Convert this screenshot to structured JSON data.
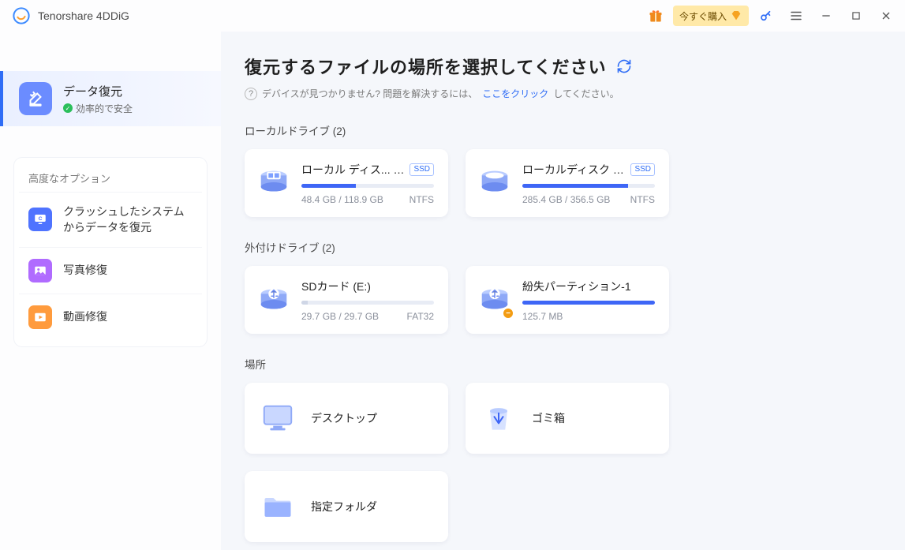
{
  "app": {
    "title": "Tenorshare 4DDiG"
  },
  "titlebar": {
    "buy_label": "今すぐ購入"
  },
  "sidebar": {
    "primary": {
      "title": "データ復元",
      "subtitle": "効率的で安全"
    },
    "advanced_header": "高度なオプション",
    "advanced": [
      {
        "label": "クラッシュしたシステムからデータを復元"
      },
      {
        "label": "写真修復"
      },
      {
        "label": "動画修復"
      }
    ]
  },
  "main": {
    "title": "復元するファイルの場所を選択してください",
    "help_prefix": "デバイスが見つかりません? 問題を解決するには、",
    "help_link": "ここをクリック",
    "help_suffix": "してください。"
  },
  "sections": {
    "local": {
      "title": "ローカルドライブ (2)",
      "drives": [
        {
          "name": "ローカル ディス... (C:)",
          "ssd": "SSD",
          "used": "48.4 GB / 118.9 GB",
          "fs": "NTFS",
          "fill": 41
        },
        {
          "name": "ローカルディスク (D:)",
          "ssd": "SSD",
          "used": "285.4 GB / 356.5 GB",
          "fs": "NTFS",
          "fill": 80
        }
      ]
    },
    "external": {
      "title": "外付けドライブ (2)",
      "drives": [
        {
          "name": "SDカード (E:)",
          "used": "29.7 GB / 29.7 GB",
          "fs": "FAT32",
          "fill": 5
        },
        {
          "name": "紛失パーティション-1",
          "used": "125.7 MB",
          "fs": "",
          "fill": 100,
          "warn": true
        }
      ]
    },
    "locations": {
      "title": "場所",
      "items": [
        {
          "label": "デスクトップ"
        },
        {
          "label": "ゴミ箱"
        },
        {
          "label": "指定フォルダ"
        }
      ]
    }
  }
}
